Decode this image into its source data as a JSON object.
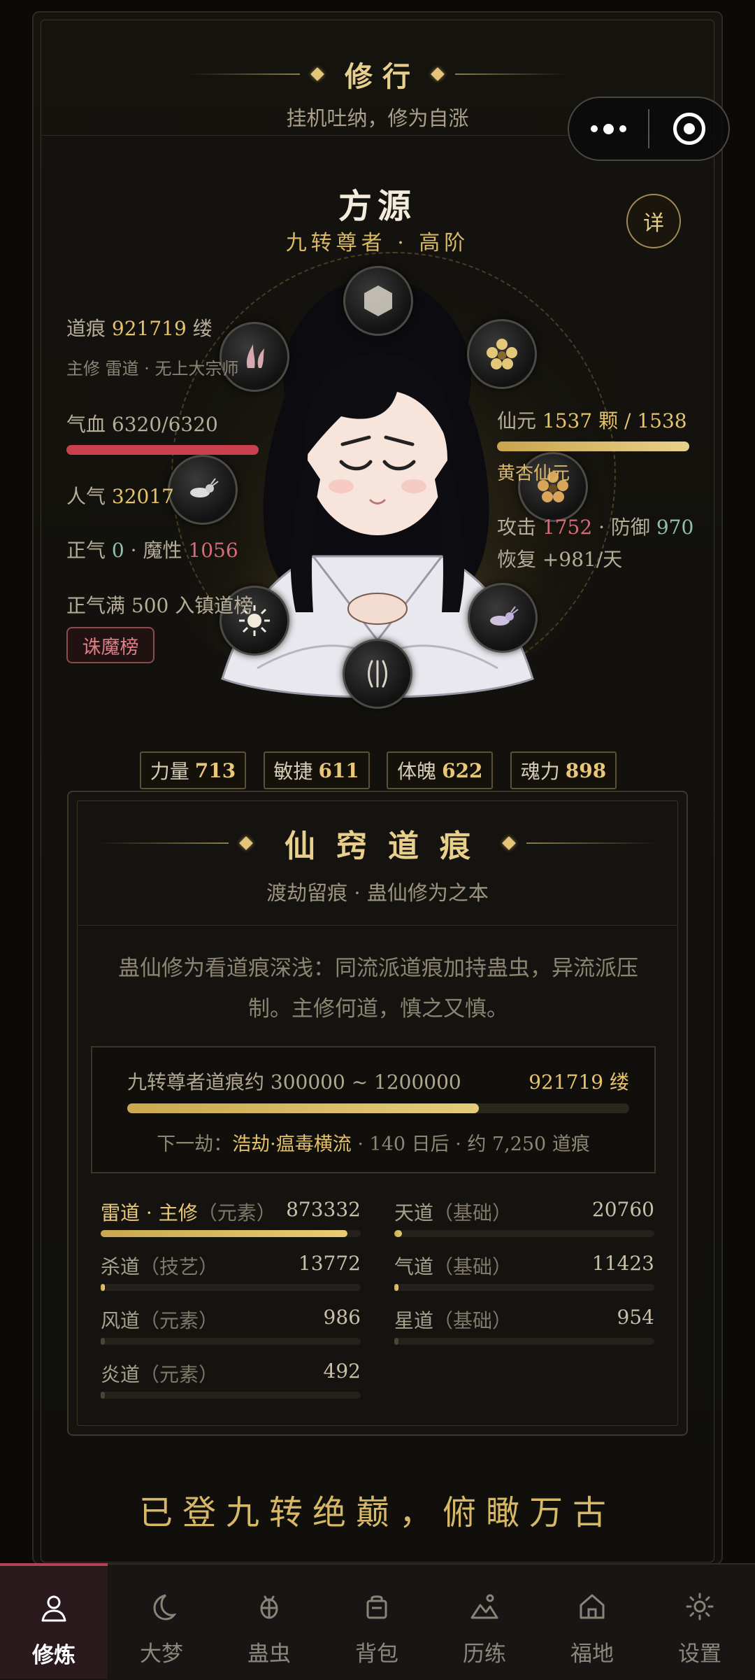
{
  "header": {
    "title": "修行",
    "subtitle": "挂机吐纳，修为自涨"
  },
  "character": {
    "name": "方源",
    "rank": "九转尊者 · 高阶",
    "detail_label": "详",
    "daohen_label": "道痕",
    "daohen_value": "921719",
    "daohen_unit": "缕",
    "main_path": "主修 雷道 · 无上大宗师",
    "qixue_label": "气血",
    "qixue_value": "6320/6320",
    "qixue_fraction": 1.0,
    "renqi_label": "人气",
    "renqi_value": "32017",
    "zhengqi_label": "正气",
    "zhengqi_value": "0",
    "moxing_label": "魔性",
    "moxing_value": "1056",
    "zhengqi_note": "正气满 500 入镇道榜",
    "zhumo_label": "诛魔榜",
    "xianyuan_label": "仙元",
    "xianyuan_value": "1537 颗 / 1538",
    "xianyuan_fraction": 0.999,
    "xianyuan_type": "黄杏仙元",
    "attack_label": "攻击",
    "attack_value": "1752",
    "defense_label": "防御",
    "defense_value": "970",
    "recover_label": "恢复",
    "recover_value": "+981/天"
  },
  "attributes": [
    {
      "label": "力量",
      "value": "713"
    },
    {
      "label": "敏捷",
      "value": "611"
    },
    {
      "label": "体魄",
      "value": "622"
    },
    {
      "label": "魂力",
      "value": "898"
    }
  ],
  "panel": {
    "title": "仙窍道痕",
    "subtitle": "渡劫留痕 · 蛊仙修为之本",
    "description": "蛊仙修为看道痕深浅：同流派道痕加持蛊虫，异流派压制。主修何道，慎之又慎。",
    "range_label": "九转尊者道痕约 300000 ~ 1200000",
    "range_value": "921719 缕",
    "range_fraction": 0.7,
    "next_prefix": "下一劫：",
    "next_name": "浩劫·瘟毒横流",
    "next_suffix": " · 140 日后 · 约 7,250 道痕",
    "daos": [
      {
        "name": "雷道 · 主修",
        "cat": "（元素）",
        "value": "873332",
        "fraction": 0.95,
        "main": true
      },
      {
        "name": "天道",
        "cat": "（基础）",
        "value": "20760",
        "fraction": 0.03,
        "main": false
      },
      {
        "name": "杀道",
        "cat": "（技艺）",
        "value": "13772",
        "fraction": 0.015,
        "main": false
      },
      {
        "name": "气道",
        "cat": "（基础）",
        "value": "11423",
        "fraction": 0.013,
        "main": false
      },
      {
        "name": "风道",
        "cat": "（元素）",
        "value": "986",
        "fraction": 0.0,
        "main": false
      },
      {
        "name": "星道",
        "cat": "（基础）",
        "value": "954",
        "fraction": 0.0,
        "main": false
      },
      {
        "name": "炎道",
        "cat": "（元素）",
        "value": "492",
        "fraction": 0.0,
        "main": false
      }
    ]
  },
  "footer_text": "已登九转绝巅，俯瞰万古",
  "tabs": [
    {
      "label": "修炼",
      "icon": "person-icon",
      "active": true
    },
    {
      "label": "大梦",
      "icon": "moon-icon",
      "active": false
    },
    {
      "label": "蛊虫",
      "icon": "beetle-icon",
      "active": false
    },
    {
      "label": "背包",
      "icon": "bag-icon",
      "active": false
    },
    {
      "label": "历练",
      "icon": "mountain-icon",
      "active": false
    },
    {
      "label": "福地",
      "icon": "home-icon",
      "active": false
    },
    {
      "label": "设置",
      "icon": "gear-icon",
      "active": false
    }
  ],
  "colors": {
    "gold": "#e6c46e",
    "red": "#d96a7a",
    "active_tab": "#b54355"
  }
}
